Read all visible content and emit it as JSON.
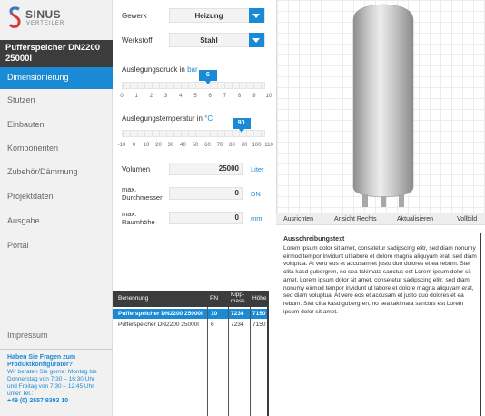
{
  "brand": {
    "name": "SINUS",
    "sub": "VERTEILER",
    "accent": "#1a8ad4",
    "dark": "#3c3c3c"
  },
  "product": {
    "title": "Pufferspeicher DN2200 25000l"
  },
  "sidebar": {
    "active": "Dimensionierung",
    "items": [
      "Stutzen",
      "Einbauten",
      "Komponenten",
      "Zubehör/Dämmung",
      "Projektdaten",
      "Ausgabe",
      "Portal"
    ],
    "impressum": "Impressum"
  },
  "help": {
    "title": "Haben Sie Fragen zum Produktkonfigurator?",
    "body": "Wir beraten Sie gerne: Montag bis Donnerstag von 7:30 – 16:30 Uhr und Freitag von 7:30 – 12:45 Uhr unter Tel.:",
    "phone": "+49 (0) 2557 9393 10"
  },
  "form": {
    "gewerk": {
      "label": "Gewerk",
      "value": "Heizung"
    },
    "werkstoff": {
      "label": "Werkstoff",
      "value": "Stahl"
    },
    "druck": {
      "label": "Auslegungsdruck in",
      "unit": "bar",
      "value": "6",
      "level": 0.6,
      "ticks": [
        "0",
        "1",
        "2",
        "3",
        "4",
        "5",
        "6",
        "7",
        "8",
        "9",
        "10"
      ]
    },
    "temperatur": {
      "label": "Auslegungstemperatur in",
      "unit": "°C",
      "value": "90",
      "level": 0.833,
      "ticks": [
        "-10",
        "0",
        "10",
        "20",
        "30",
        "40",
        "50",
        "60",
        "70",
        "80",
        "90",
        "100",
        "110"
      ]
    },
    "volumen": {
      "label": "Volumen",
      "value": "25000",
      "unit": "Liter"
    },
    "durchmesser": {
      "label1": "max.",
      "label2": "Durchmesser",
      "value": "0",
      "unit": "DN"
    },
    "raumhoehe": {
      "label1": "max.",
      "label2": "Raumhöhe",
      "value": "0",
      "unit": "mm"
    }
  },
  "table": {
    "headers": [
      "Benennung",
      "PN",
      "Kipp-",
      "mass",
      "Höhe"
    ],
    "rows": [
      {
        "name": "Pufferspeicher DN2200 25000l",
        "pn": "10",
        "kipp": "7234",
        "hoehe": "7150"
      },
      {
        "name": "Pufferspeicher DN2200 25000l",
        "pn": "6",
        "kipp": "7234",
        "hoehe": "7150"
      }
    ]
  },
  "viewer": {
    "tabs": [
      "Ausrichten",
      "Ansicht Rechts",
      "Aktualisieren",
      "Vollbild"
    ]
  },
  "spec": {
    "title": "Ausschreibungstext",
    "body": "Lorem ipsum dolor sit amet, consetetur sadipscing elitr, sed diam nonumy eirmod tempor invidunt ut labore et dolore magna aliquyam erat, sed diam voluptua. At vero eos et accusam et justo duo dolores et ea rebum. Stet clita kasd gubergren, no sea takimata sanctus est Lorem ipsum dolor sit amet. Lorem ipsum dolor sit amet, consetetur sadipscing elitr, sed diam nonumy eirmod tempor invidunt ut labore et dolore magna aliquyam erat, sed diam voluptua. At vero eos et accusam et justo duo dolores et ea rebum. Stet clita kasd gubergren, no sea takimata sanctus est Lorem ipsum dolor sit amet."
  }
}
